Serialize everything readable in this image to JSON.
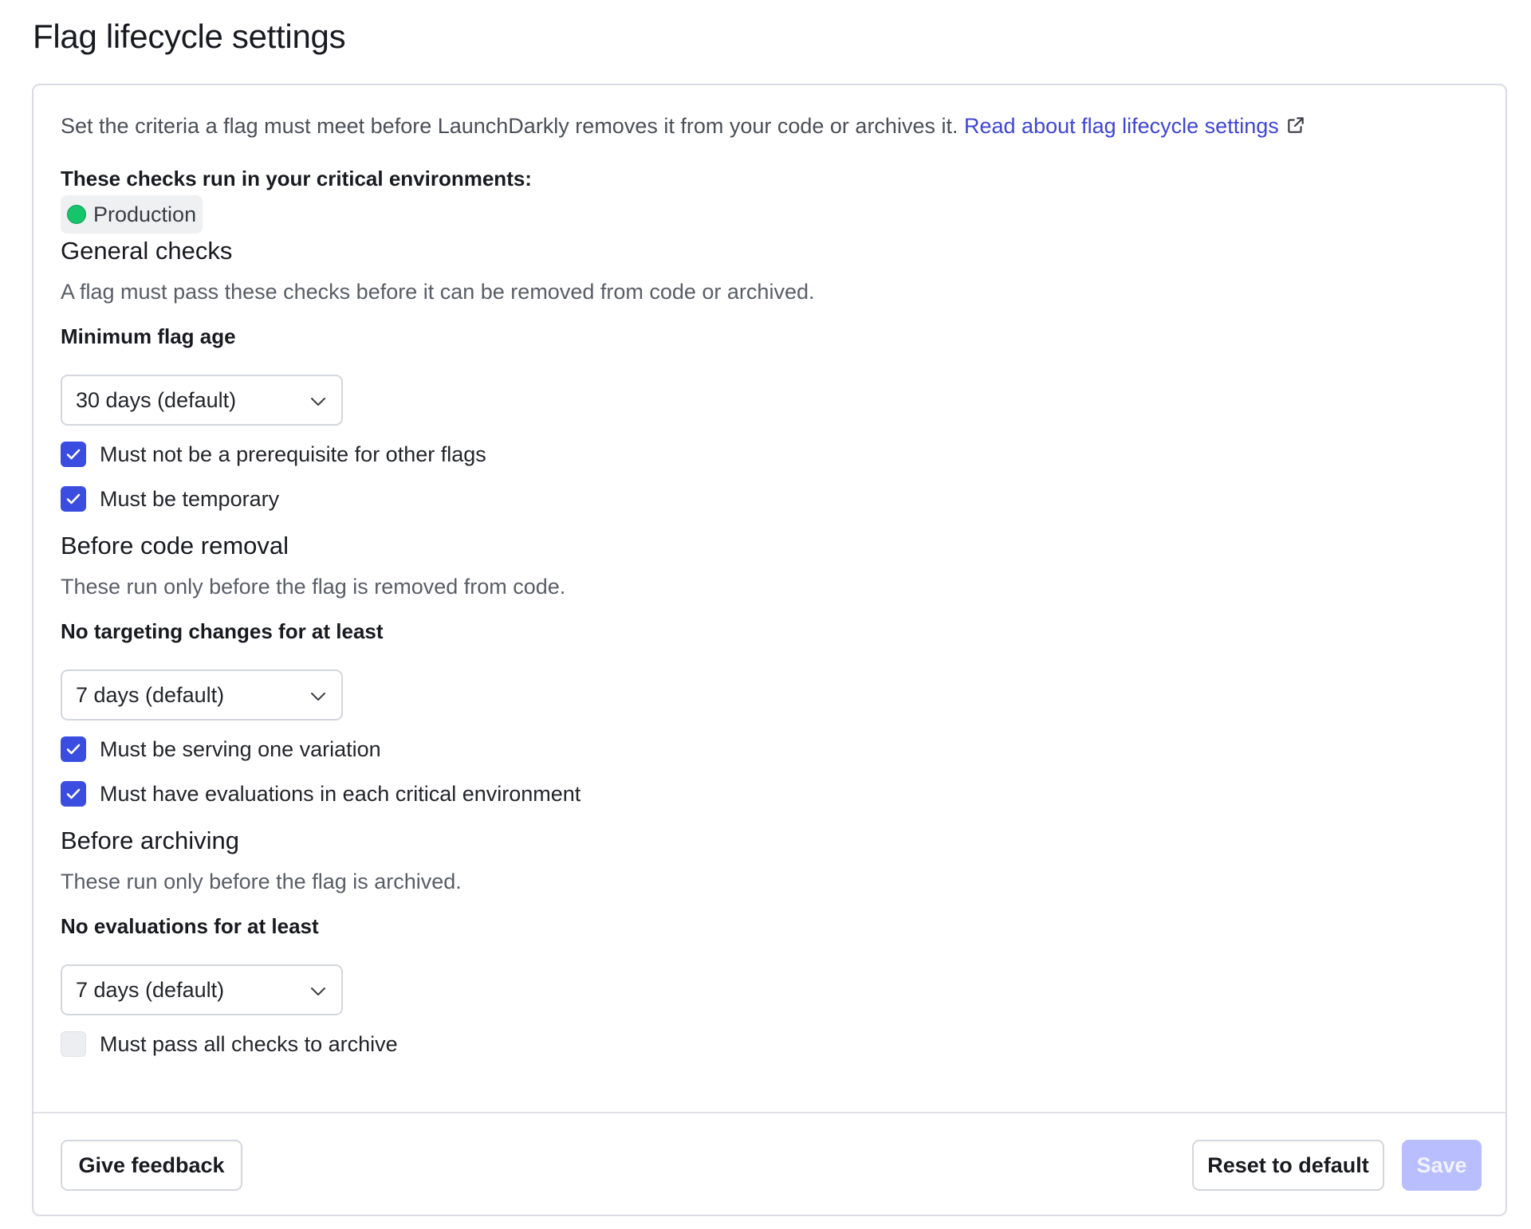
{
  "page": {
    "title": "Flag lifecycle settings"
  },
  "intro": {
    "text": "Set the criteria a flag must meet before LaunchDarkly removes it from your code or archives it.",
    "link_text": "Read about flag lifecycle settings",
    "link_icon": "external-link-icon"
  },
  "environments": {
    "label": "These checks run in your critical environments:",
    "chips": [
      {
        "name": "Production",
        "color": "#16c46b"
      }
    ]
  },
  "general_checks": {
    "title": "General checks",
    "description": "A flag must pass these checks before it can be removed from code or archived.",
    "min_age_label": "Minimum flag age",
    "min_age_value": "30 days (default)",
    "checks": [
      {
        "label": "Must not be a prerequisite for other flags",
        "checked": true
      },
      {
        "label": "Must be temporary",
        "checked": true
      }
    ]
  },
  "before_code_removal": {
    "title": "Before code removal",
    "description": "These run only before the flag is removed from code.",
    "targeting_label": "No targeting changes for at least",
    "targeting_value": "7 days (default)",
    "checks": [
      {
        "label": "Must be serving one variation",
        "checked": true
      },
      {
        "label": "Must have evaluations in each critical environment",
        "checked": true
      }
    ]
  },
  "before_archiving": {
    "title": "Before archiving",
    "description": "These run only before the flag is archived.",
    "evaluations_label": "No evaluations for at least",
    "evaluations_value": "7 days (default)",
    "checks": [
      {
        "label": "Must pass all checks to archive",
        "checked": false
      }
    ]
  },
  "footer": {
    "feedback_label": "Give feedback",
    "reset_label": "Reset to default",
    "save_label": "Save",
    "save_disabled": true
  },
  "colors": {
    "accent": "#3b4de0",
    "link": "#3f45d6",
    "save_disabled_bg": "#b8beff",
    "env_dot": "#16c46b"
  }
}
